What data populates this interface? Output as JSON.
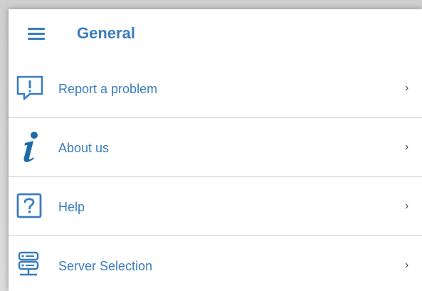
{
  "header": {
    "menu_icon": "hamburger-menu-icon",
    "title": "General"
  },
  "items": [
    {
      "label": "Report a problem",
      "icon": "report-problem-icon",
      "chevron": "›"
    },
    {
      "label": "About us",
      "icon": "info-icon",
      "chevron": "›"
    },
    {
      "label": "Help",
      "icon": "help-icon",
      "chevron": "›"
    },
    {
      "label": "Server Selection",
      "icon": "server-icon",
      "chevron": "›"
    }
  ],
  "colors": {
    "accent": "#3b7dbf",
    "info_icon": "#1f6aa8",
    "divider": "#cfcfcf"
  }
}
